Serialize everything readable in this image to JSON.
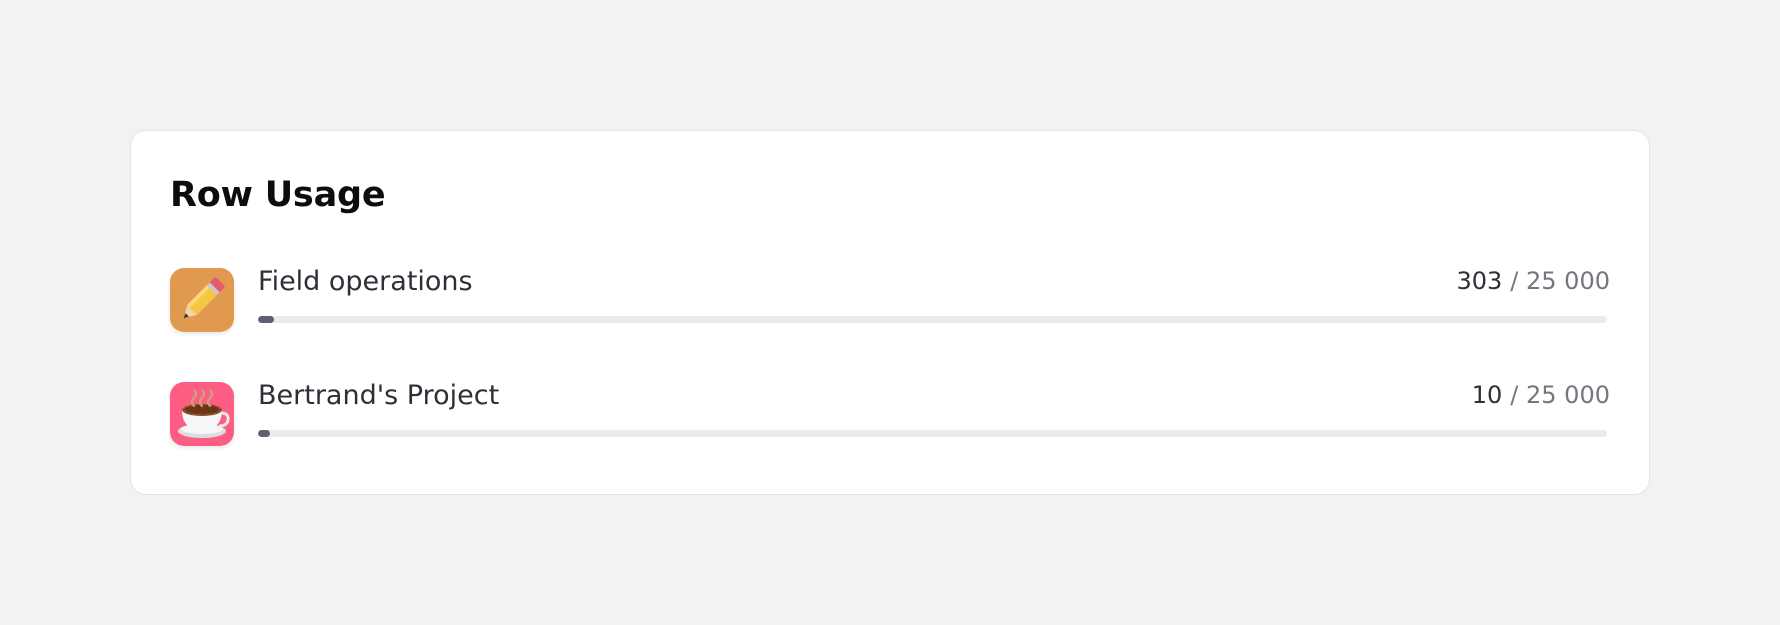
{
  "card": {
    "title": "Row Usage"
  },
  "rows": [
    {
      "name": "Field operations",
      "used": "303",
      "limit": "/ 25 000",
      "usage_fraction": 0.01212,
      "icon": "pencil-icon",
      "icon_bg": "#e0994f"
    },
    {
      "name": "Bertrand's Project",
      "used": "10",
      "limit": "/ 25 000",
      "usage_fraction": 0.0004,
      "icon": "hot-beverage-icon",
      "icon_bg": "#fd5d82"
    }
  ],
  "colors": {
    "bar_fill": "#615e74",
    "bar_track": "#ebebeb"
  }
}
